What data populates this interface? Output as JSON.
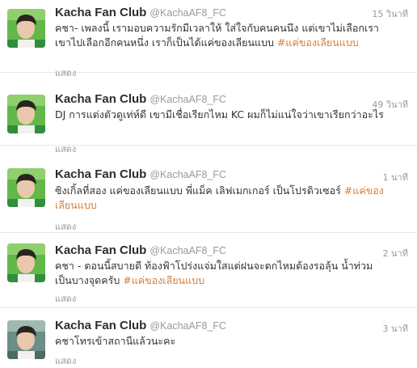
{
  "tweets": [
    {
      "name": "Kacha Fan Club",
      "handle": "@KachaAF8_FC",
      "time": "15 วินาที",
      "text": "คชา- เพลงนี้ เรามอบความรักมีเวลาให้ ใส่ใจกับคนคนนึง แต่เขาไม่เลือกเรา เขาไปเลือกอีกคนหนึ่ง เราก็เป็นได้แค่ของเลียนแบบ ",
      "hashtag": "#แค่ของเลียนแบบ",
      "expand": "แสดง"
    },
    {
      "name": "Kacha Fan Club",
      "handle": "@KachaAF8_FC",
      "time": "49 วินาที",
      "text": "DJ การแต่งตัวดูเท่ห์ดี เขามีเชื่อเรียกไหม KC ผมก็ไม่แน่ใจว่าเขาเรียกว่าอะไร",
      "hashtag": "",
      "expand": "แสดง"
    },
    {
      "name": "Kacha Fan Club",
      "handle": "@KachaAF8_FC",
      "time": "1 นาที",
      "text": "ซิงเกิ้ลที่สอง แค่ของเลียนแบบ พี่แม็ค เลิฟเมกเกอร์ เป็นโปรดิวเซอร์ ",
      "hashtag": "#แค่ของเลียนแบบ",
      "expand": "แสดง"
    },
    {
      "name": "Kacha Fan Club",
      "handle": "@KachaAF8_FC",
      "time": "2 นาที",
      "text": "คชา - ตอนนี้สบายดี ท้องฟ้าโปร่งแจ่มใสแต่ฝนจะตกไหมต้องรอลุ้น น้ำท่วมเป็นบางจุดครับ ",
      "hashtag": "#แค่ของเลียนแบบ",
      "expand": "แสดง"
    },
    {
      "name": "Kacha Fan Club",
      "handle": "@KachaAF8_FC",
      "time": "3 นาที",
      "text": "คชาโทรเข้าสถานีแล้วนะคะ",
      "hashtag": "",
      "expand": "แสดง"
    }
  ]
}
